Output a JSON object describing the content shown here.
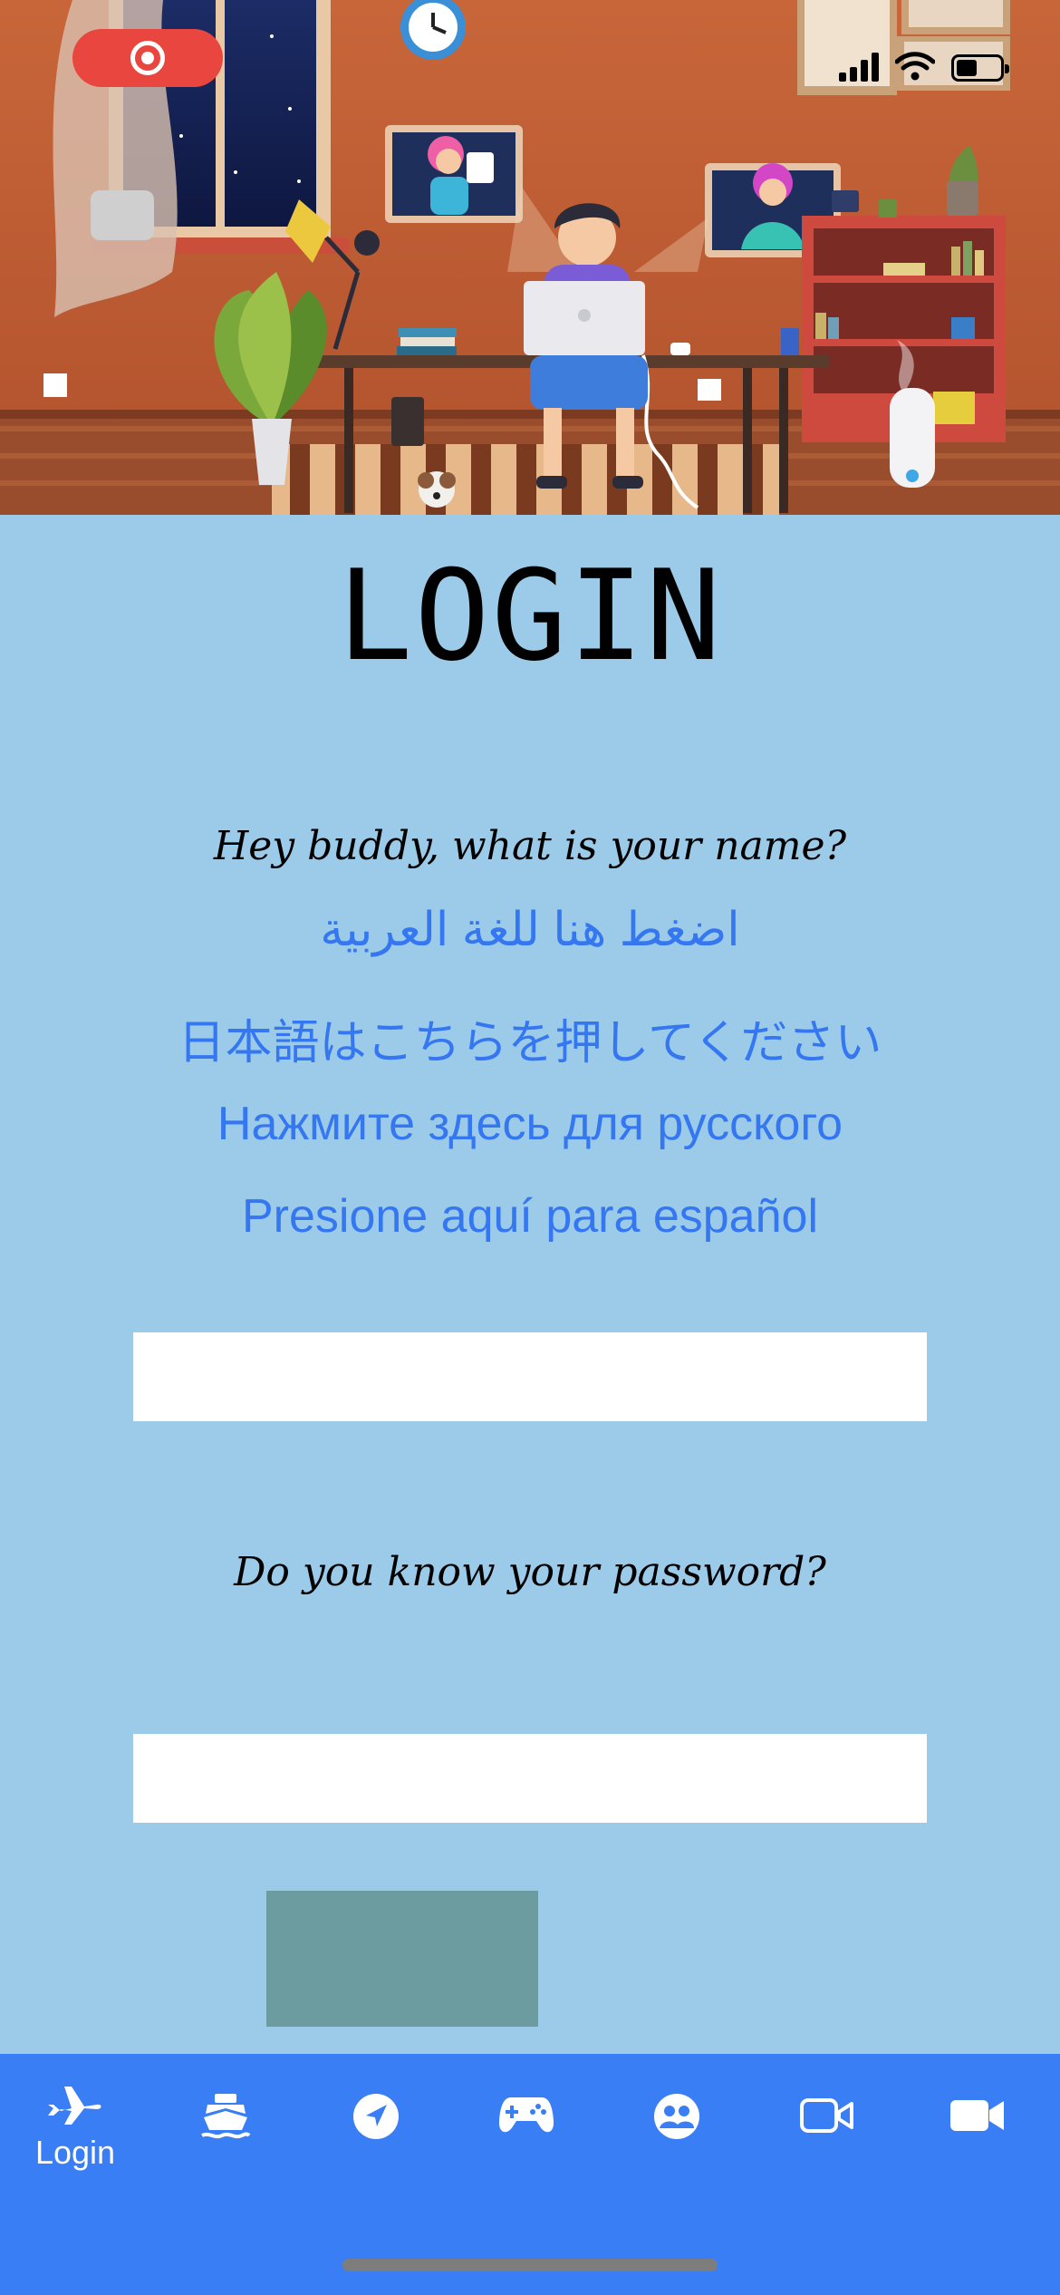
{
  "status_bar": {
    "recording": true
  },
  "login": {
    "title": "LOGIN",
    "name_prompt": "Hey buddy, what is your name?",
    "language_links": [
      "اضغط هنا للغة العربية",
      "日本語はこちらを押してください",
      "Нажмите здесь для русского",
      "Presione aquí para español"
    ],
    "name_value": "",
    "password_prompt": "Do you know your password?",
    "password_value": ""
  },
  "tabbar": {
    "tabs": [
      {
        "icon": "airplane-icon",
        "label": "Login",
        "selected": true
      },
      {
        "icon": "boat-icon",
        "label": ""
      },
      {
        "icon": "navigation-arrow-icon",
        "label": ""
      },
      {
        "icon": "gamepad-icon",
        "label": ""
      },
      {
        "icon": "people-icon",
        "label": ""
      },
      {
        "icon": "video-outline-icon",
        "label": ""
      },
      {
        "icon": "video-filled-icon",
        "label": ""
      }
    ]
  },
  "colors": {
    "background": "#9ccbe9",
    "link": "#3577f0",
    "tabbar": "#3a7ef5",
    "submit_button": "#6c9ba0",
    "record_pill": "#e8463f"
  }
}
